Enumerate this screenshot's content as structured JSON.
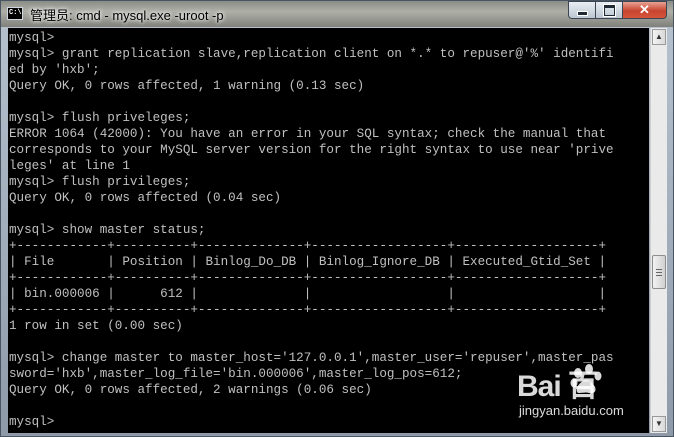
{
  "window": {
    "title": "管理员: cmd - mysql.exe  -uroot -p",
    "icon_text": "C:\\",
    "controls": {
      "minimize": "minimize-icon",
      "maximize": "maximize-icon",
      "close": "close-icon"
    }
  },
  "console": {
    "lines": [
      "mysql>",
      "mysql> grant replication slave,replication client on *.* to repuser@'%' identifi",
      "ed by 'hxb';",
      "Query OK, 0 rows affected, 1 warning (0.13 sec)",
      "",
      "mysql> flush priveleges;",
      "ERROR 1064 (42000): You have an error in your SQL syntax; check the manual that",
      "corresponds to your MySQL server version for the right syntax to use near 'prive",
      "leges' at line 1",
      "mysql> flush privileges;",
      "Query OK, 0 rows affected (0.04 sec)",
      "",
      "mysql> show master status;",
      "+------------+----------+--------------+------------------+-------------------+",
      "| File       | Position | Binlog_Do_DB | Binlog_Ignore_DB | Executed_Gtid_Set |",
      "+------------+----------+--------------+------------------+-------------------+",
      "| bin.000006 |      612 |              |                  |                   |",
      "+------------+----------+--------------+------------------+-------------------+",
      "1 row in set (0.00 sec)",
      "",
      "mysql> change master to master_host='127.0.0.1',master_user='repuser',master_pas",
      "sword='hxb',master_log_file='bin.000006',master_log_pos=612;",
      "Query OK, 0 rows affected, 2 warnings (0.06 sec)",
      "",
      "mysql>"
    ]
  },
  "scrollbar": {
    "up_arrow": "▲",
    "down_arrow": "▼"
  },
  "watermark": {
    "logo": "Bai  百",
    "site": "jingyan.baidu.com"
  }
}
